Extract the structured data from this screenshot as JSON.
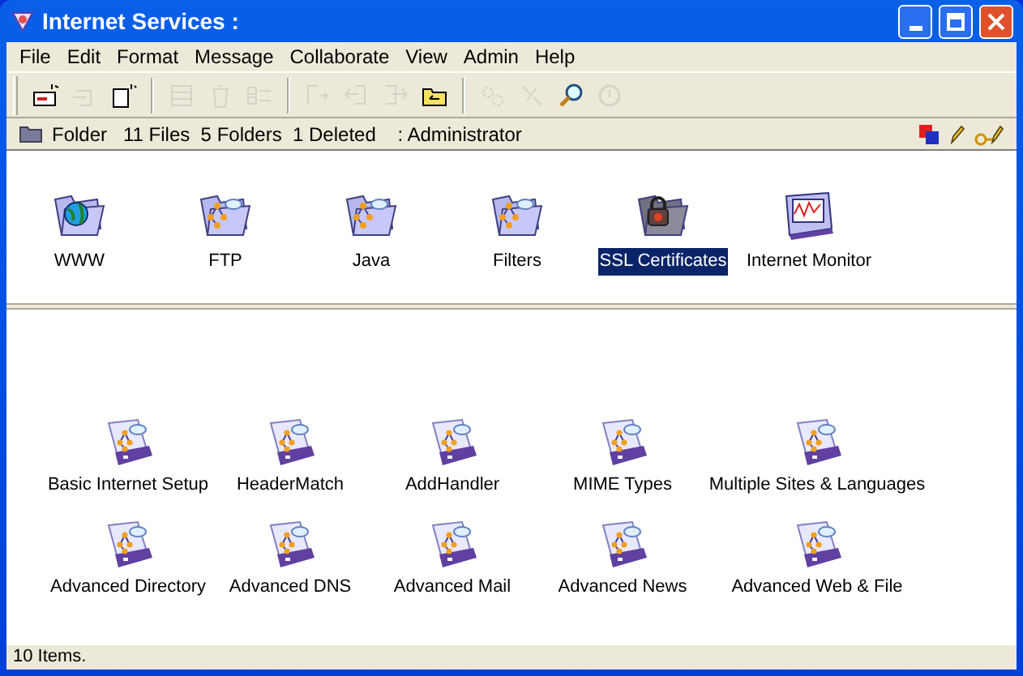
{
  "window": {
    "title": "Internet Services :"
  },
  "menu": [
    "File",
    "Edit",
    "Format",
    "Message",
    "Collaborate",
    "View",
    "Admin",
    "Help"
  ],
  "toolbar": [
    {
      "kind": "new-memo",
      "disabled": false
    },
    {
      "kind": "reply",
      "disabled": true
    },
    {
      "kind": "new-page",
      "disabled": false
    },
    {
      "kind": "sep"
    },
    {
      "kind": "save",
      "disabled": true
    },
    {
      "kind": "trash",
      "disabled": true
    },
    {
      "kind": "properties",
      "disabled": true
    },
    {
      "kind": "sep"
    },
    {
      "kind": "move",
      "disabled": true
    },
    {
      "kind": "back",
      "disabled": true
    },
    {
      "kind": "forward",
      "disabled": true
    },
    {
      "kind": "folder",
      "disabled": false
    },
    {
      "kind": "sep"
    },
    {
      "kind": "gears",
      "disabled": true
    },
    {
      "kind": "tools",
      "disabled": true
    },
    {
      "kind": "search",
      "disabled": false
    },
    {
      "kind": "refresh",
      "disabled": true
    }
  ],
  "info_bar": {
    "text": "Folder   11 Files  5 Folders  1 Deleted    : Administrator"
  },
  "folders": [
    {
      "label": "WWW",
      "kind": "globe",
      "selected": false
    },
    {
      "label": "FTP",
      "kind": "network",
      "selected": false
    },
    {
      "label": "Java",
      "kind": "network",
      "selected": false
    },
    {
      "label": "Filters",
      "kind": "network",
      "selected": false
    },
    {
      "label": "SSL Certificates",
      "kind": "lock",
      "selected": true
    },
    {
      "label": "Internet Monitor",
      "kind": "monitor",
      "selected": false
    }
  ],
  "documents": [
    {
      "label": "Basic Internet Setup"
    },
    {
      "label": "HeaderMatch"
    },
    {
      "label": "AddHandler"
    },
    {
      "label": "MIME Types"
    },
    {
      "label": "Multiple Sites & Languages"
    },
    {
      "label": "Advanced Directory"
    },
    {
      "label": "Advanced DNS"
    },
    {
      "label": "Advanced Mail"
    },
    {
      "label": "Advanced News"
    },
    {
      "label": "Advanced Web & File"
    }
  ],
  "status_bar": {
    "text": "10 Items."
  }
}
